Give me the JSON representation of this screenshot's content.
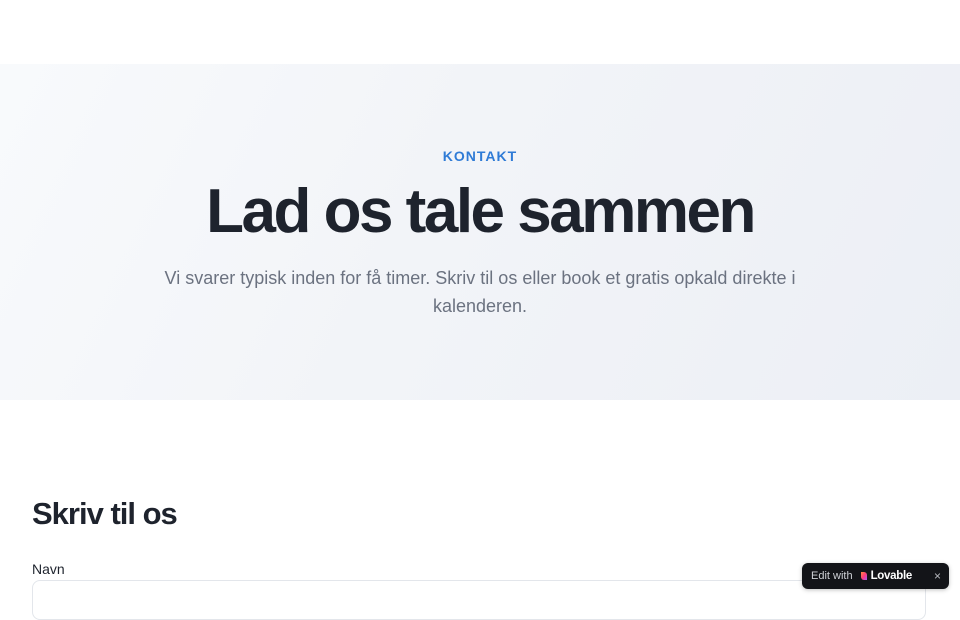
{
  "hero": {
    "eyebrow": "KONTAKT",
    "title": "Lad os tale sammen",
    "subtitle": "Vi svarer typisk inden for få timer. Skriv til os eller book et gratis opkald direkte i kalenderen."
  },
  "form": {
    "section_title": "Skriv til os",
    "name_label": "Navn",
    "name_value": ""
  },
  "badge": {
    "prefix": "Edit with",
    "brand": "Lovable",
    "close": "×",
    "brand_colors": [
      "#ff5a5f",
      "#ff3a7a",
      "#a855f7"
    ]
  },
  "colors": {
    "accent": "#2f7bd6",
    "heading": "#1e232d",
    "muted": "#6b7280"
  }
}
